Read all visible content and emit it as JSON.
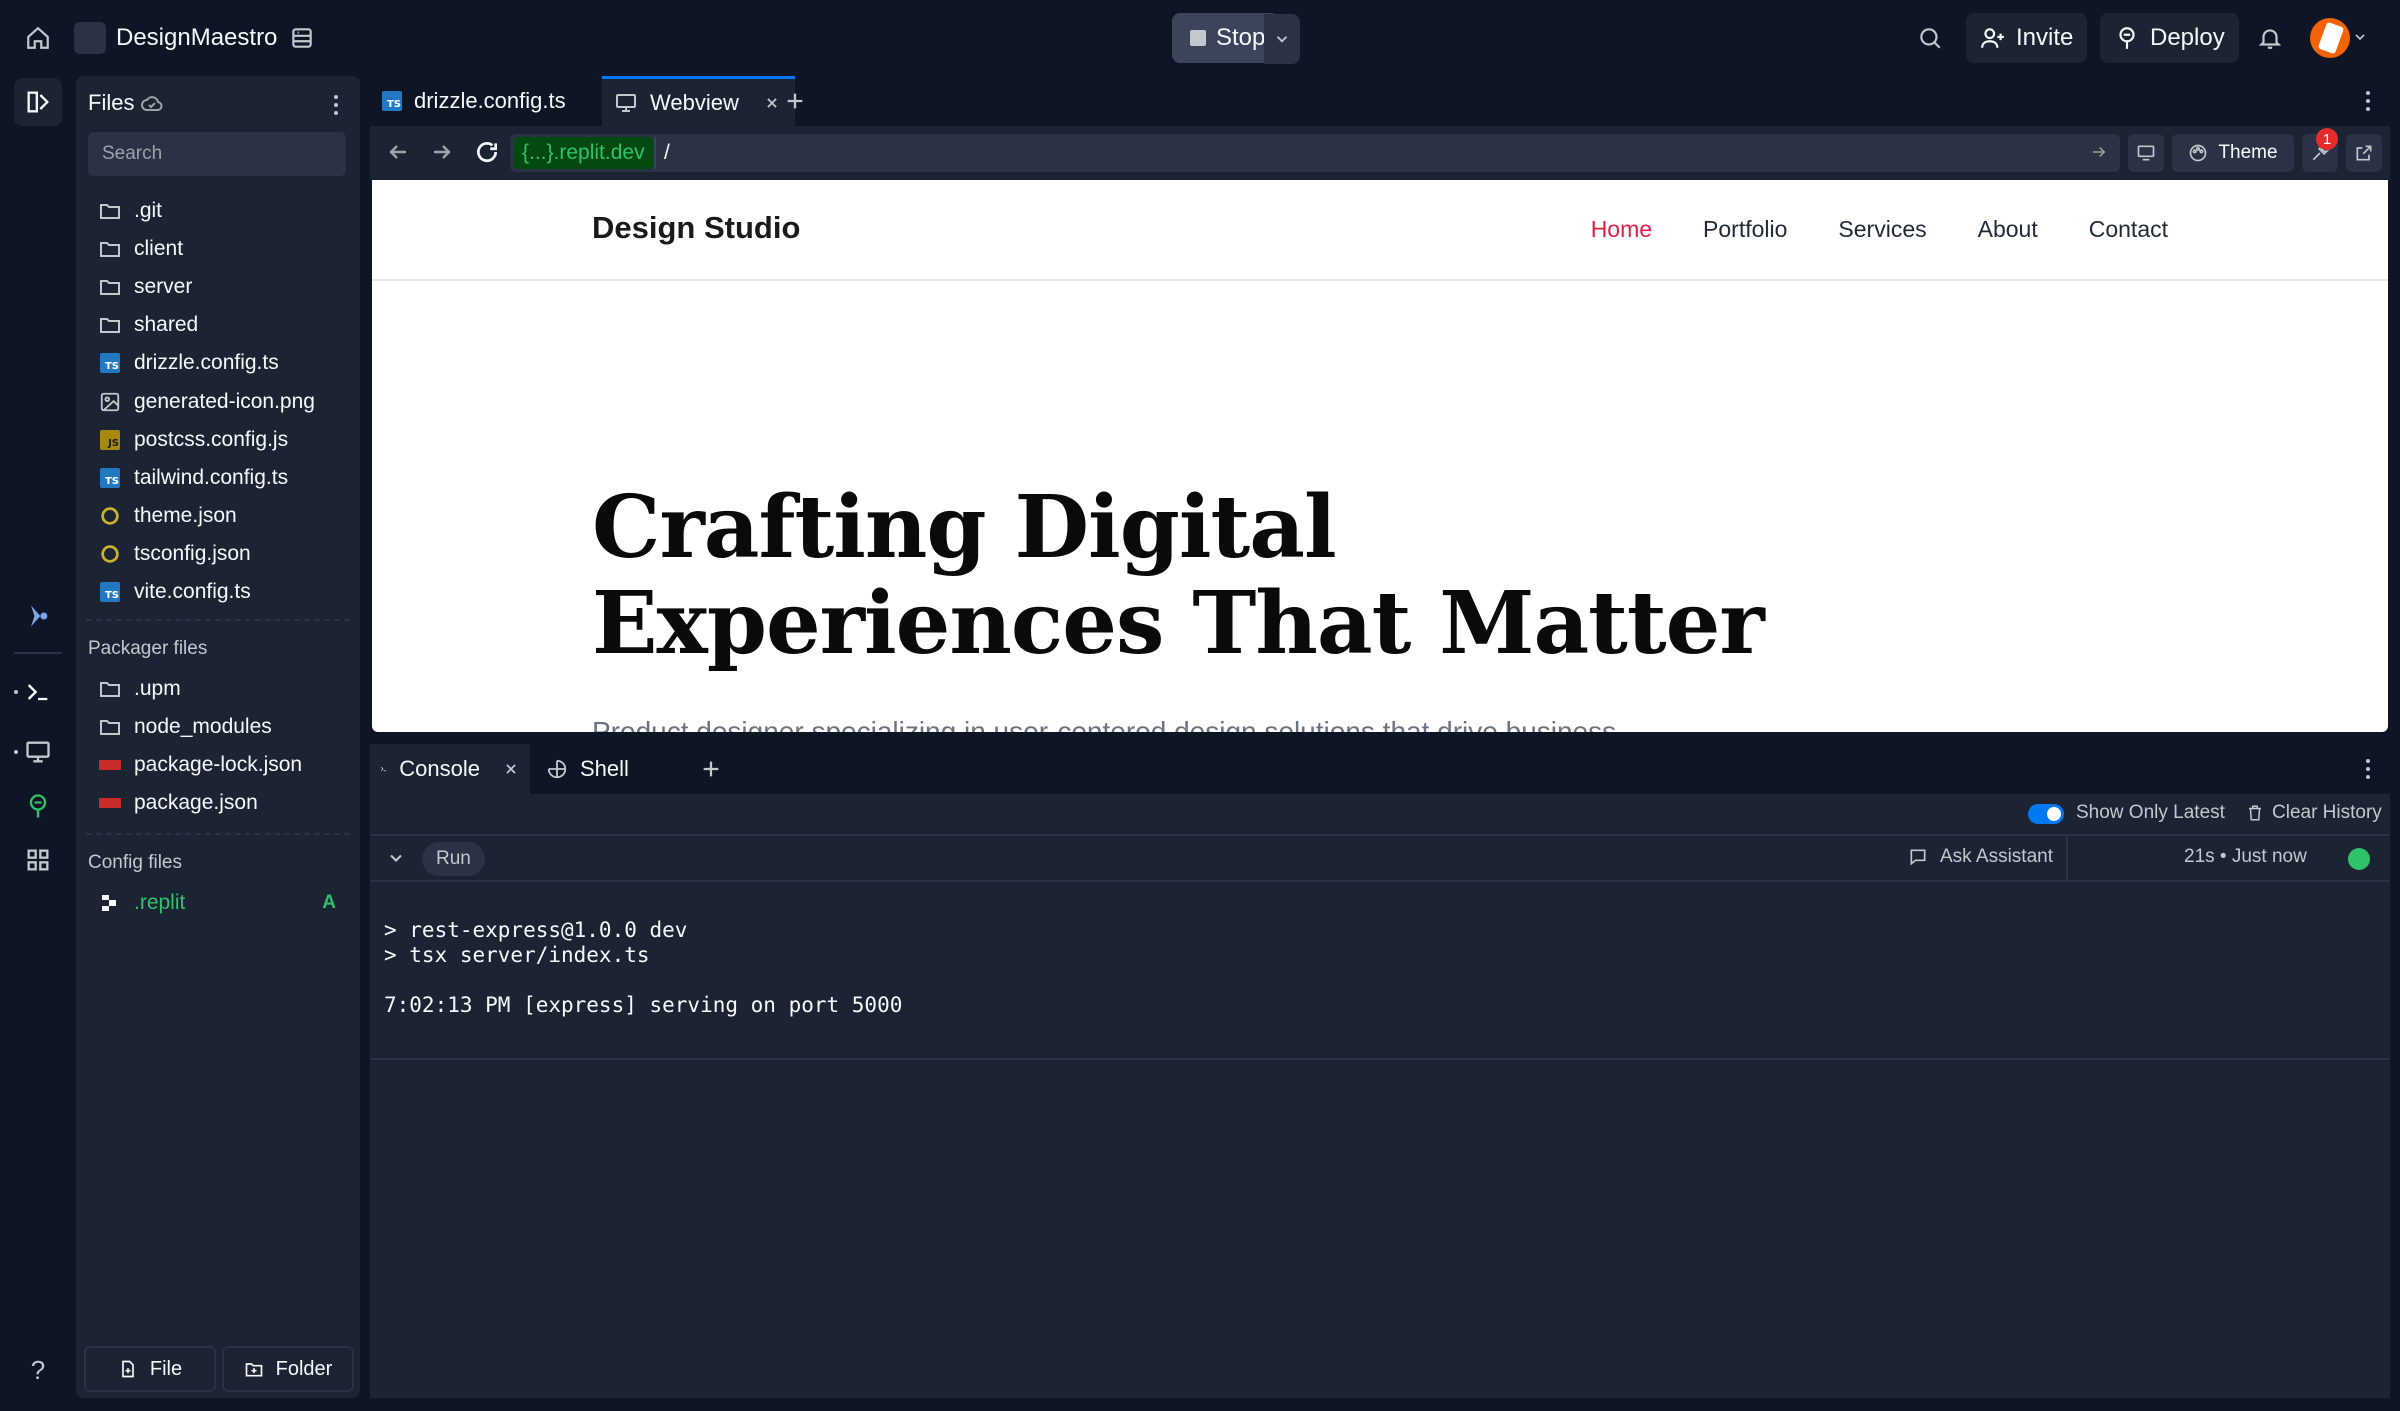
{
  "app": {
    "project_name": "DesignMaestro",
    "stop_label": "Stop",
    "invite_label": "Invite",
    "deploy_label": "Deploy",
    "notification_count": "1"
  },
  "files_panel": {
    "title": "Files",
    "search_placeholder": "Search",
    "files": [
      {
        "name": ".git",
        "icon": "folder-icon"
      },
      {
        "name": "client",
        "icon": "folder-icon"
      },
      {
        "name": "server",
        "icon": "folder-icon"
      },
      {
        "name": "shared",
        "icon": "folder-icon"
      },
      {
        "name": "drizzle.config.ts",
        "icon": "ts-file-icon"
      },
      {
        "name": "generated-icon.png",
        "icon": "image-file-icon"
      },
      {
        "name": "postcss.config.js",
        "icon": "js-file-icon"
      },
      {
        "name": "tailwind.config.ts",
        "icon": "ts-file-icon"
      },
      {
        "name": "theme.json",
        "icon": "json-file-icon"
      },
      {
        "name": "tsconfig.json",
        "icon": "json-file-icon"
      },
      {
        "name": "vite.config.ts",
        "icon": "ts-file-icon"
      }
    ],
    "packager_label": "Packager files",
    "packager_files": [
      {
        "name": ".upm",
        "icon": "folder-icon"
      },
      {
        "name": "node_modules",
        "icon": "folder-icon"
      },
      {
        "name": "package-lock.json",
        "icon": "npm-file-icon"
      },
      {
        "name": "package.json",
        "icon": "npm-file-icon"
      }
    ],
    "config_label": "Config files",
    "config_file": ".replit",
    "config_file_status": "A",
    "new_file_label": "File",
    "new_folder_label": "Folder"
  },
  "editor_tabs": {
    "tab1": "drizzle.config.ts",
    "tab2": "Webview"
  },
  "webview_bar": {
    "domain": "{...}.replit.dev",
    "path": "/",
    "theme_label": "Theme"
  },
  "site": {
    "brand": "Design Studio",
    "nav": [
      "Home",
      "Portfolio",
      "Services",
      "About",
      "Contact"
    ],
    "hero_line1": "Crafting Digital",
    "hero_line2": "Experiences That Matter",
    "hero_sub": "Product designer specializing in user-centered design solutions that drive business"
  },
  "console": {
    "tab_console": "Console",
    "tab_shell": "Shell",
    "show_only_latest": "Show Only Latest",
    "clear_history": "Clear History",
    "run_label": "Run",
    "ask_assistant": "Ask Assistant",
    "timing": "21s • Just now",
    "lines": [
      "> rest-express@1.0.0 dev",
      "> tsx server/index.ts",
      "",
      "7:02:13 PM [express] serving on port 5000"
    ]
  },
  "colors": {
    "bg": "#0e1525",
    "panel": "#1c2333",
    "accent_green": "#2fc26b",
    "nav_active": "#e11d48",
    "toggle_blue": "#0079f2"
  }
}
